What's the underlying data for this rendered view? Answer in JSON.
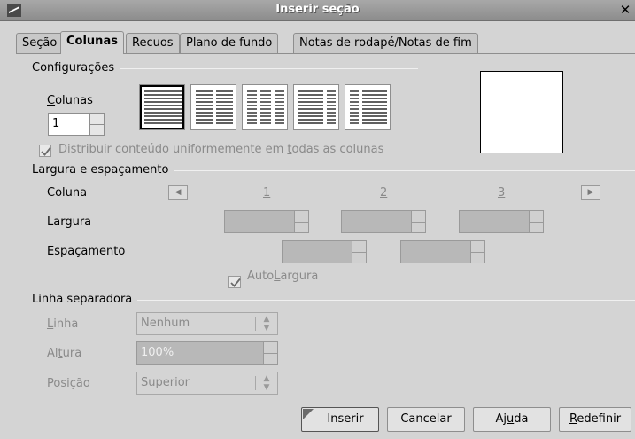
{
  "window": {
    "title": "Inserir seção"
  },
  "tabs": [
    {
      "label": "Seção",
      "active": false
    },
    {
      "label": "Colunas",
      "active": true
    },
    {
      "label": "Recuos",
      "active": false
    },
    {
      "label": "Plano de fundo",
      "active": false
    },
    {
      "label": "Notas de rodapé/Notas de fim",
      "active": false
    }
  ],
  "settings": {
    "group_label": "Configurações",
    "columns_label": "Colunas",
    "columns_mnemonic": "C",
    "columns_label_rest": "olunas",
    "columns_value": "1",
    "presets": [
      "1 coluna",
      "2 colunas",
      "3 colunas",
      "2 colunas esquerda maior",
      "2 colunas direita maior"
    ],
    "distribute_pre": "Distribuir conteúdo uniformemente em ",
    "distribute_mnemonic": "t",
    "distribute_post": "odas as colunas",
    "distribute_checked": true
  },
  "width_spacing": {
    "group_label": "Largura e espaçamento",
    "coluna_label": "Coluna",
    "column_numbers": [
      "1",
      "2",
      "3"
    ],
    "largura_label": "Largura",
    "espacamento_label": "Espaçamento",
    "autowidth_pre": "Auto",
    "autowidth_mnemonic": "L",
    "autowidth_post": "argura",
    "autowidth_checked": true
  },
  "separator": {
    "group_label": "Linha separadora",
    "linha_mn": "L",
    "linha_rest": "inha",
    "linha_value": "Nenhum",
    "altura_pre": "Al",
    "altura_mn": "t",
    "altura_post": "ura",
    "altura_value": "100%",
    "posicao_mn": "P",
    "posicao_rest": "osição",
    "posicao_value": "Superior"
  },
  "buttons": {
    "insert": "Inserir",
    "cancel": "Cancelar",
    "help_pre": "Aj",
    "help_mn": "u",
    "help_post": "da",
    "reset_mn": "R",
    "reset_rest": "edefinir"
  }
}
